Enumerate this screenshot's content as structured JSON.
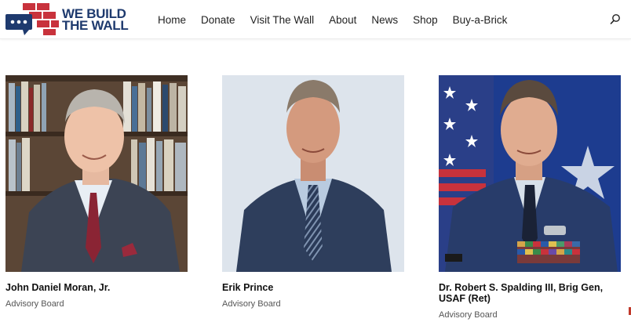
{
  "brand": {
    "name_line1": "WE BUILD",
    "name_line2": "THE WALL",
    "colors": {
      "navy": "#1e3a6e",
      "red": "#c8323c"
    }
  },
  "nav": {
    "items": [
      {
        "label": "Home"
      },
      {
        "label": "Donate"
      },
      {
        "label": "Visit The Wall"
      },
      {
        "label": "About"
      },
      {
        "label": "News"
      },
      {
        "label": "Shop"
      },
      {
        "label": "Buy-a-Brick"
      }
    ],
    "search_icon": "search-icon"
  },
  "board": [
    {
      "name": "John Daniel Moran, Jr.",
      "role": "Advisory Board",
      "photo": "portrait-photo"
    },
    {
      "name": "Erik Prince",
      "role": "Advisory Board",
      "photo": "portrait-photo"
    },
    {
      "name": "Dr. Robert S. Spalding III, Brig Gen, USAF (Ret)",
      "role": "Advisory Board",
      "photo": "portrait-photo"
    }
  ]
}
